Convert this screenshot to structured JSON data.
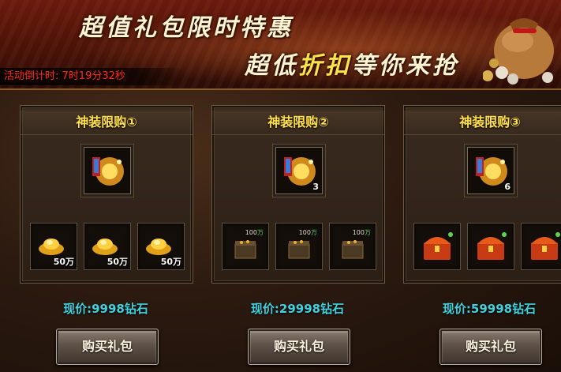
{
  "banner": {
    "title_line1": "超值礼包限时特惠",
    "title_line2_a": "超低",
    "title_line2_b": "折扣",
    "title_line2_c": "等你来抢",
    "countdown_label": "活动倒计时:",
    "countdown_value": "7时19分32秒"
  },
  "packs": [
    {
      "title": "神装限购①",
      "main_count": "",
      "items": [
        {
          "icon": "gold-ingot-icon",
          "amount": "50万"
        },
        {
          "icon": "gold-ingot-icon",
          "amount": "50万"
        },
        {
          "icon": "gold-ingot-icon",
          "amount": "50万"
        }
      ],
      "price_label": "现价:",
      "price_value": "9998钻石",
      "buy_label": "购买礼包"
    },
    {
      "title": "神装限购②",
      "main_count": "3",
      "items": [
        {
          "icon": "treasure-crate-icon",
          "tag_num": "100",
          "tag_unit": "万"
        },
        {
          "icon": "treasure-crate-icon",
          "tag_num": "100",
          "tag_unit": "万"
        },
        {
          "icon": "treasure-crate-icon",
          "tag_num": "100",
          "tag_unit": "万"
        }
      ],
      "price_label": "现价:",
      "price_value": "29998钻石",
      "buy_label": "购买礼包"
    },
    {
      "title": "神装限购③",
      "main_count": "6",
      "items": [
        {
          "icon": "treasure-chest-icon"
        },
        {
          "icon": "treasure-chest-icon"
        },
        {
          "icon": "treasure-chest-icon"
        }
      ],
      "price_label": "现价:",
      "price_value": "59998钻石",
      "buy_label": "购买礼包"
    }
  ],
  "colors": {
    "title_gold": "#ffe04a",
    "price_cyan": "#3fd2e0",
    "countdown_red": "#ff2a1a"
  }
}
